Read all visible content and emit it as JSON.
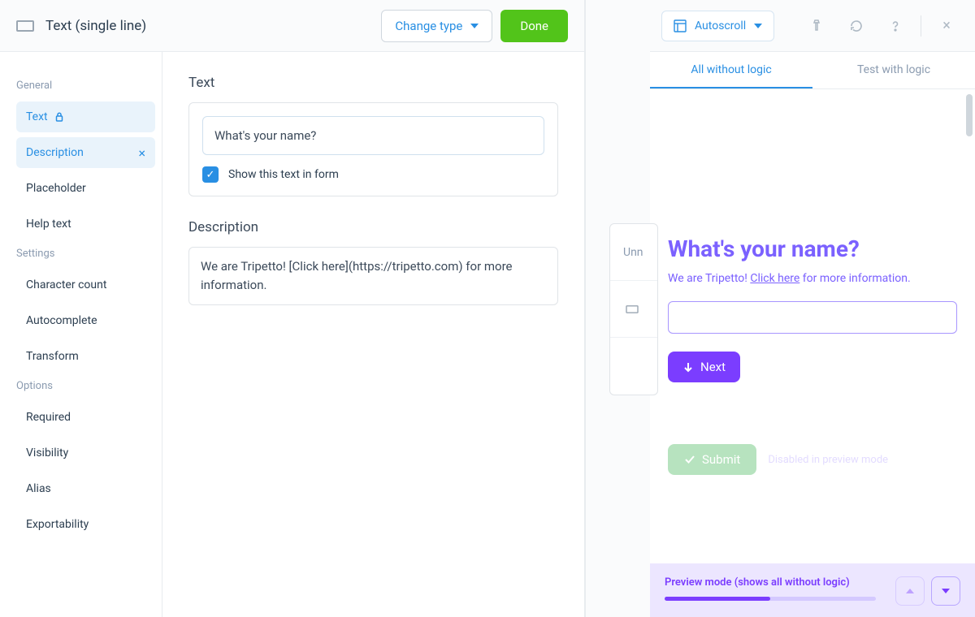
{
  "header": {
    "title": "Text (single line)",
    "change_type": "Change type",
    "done": "Done"
  },
  "sidebar": {
    "groups": [
      {
        "heading": "General",
        "items": [
          {
            "label": "Text",
            "active": true,
            "locked": true
          },
          {
            "label": "Description",
            "active": true,
            "closable": true
          },
          {
            "label": "Placeholder"
          },
          {
            "label": "Help text"
          }
        ]
      },
      {
        "heading": "Settings",
        "items": [
          {
            "label": "Character count"
          },
          {
            "label": "Autocomplete"
          },
          {
            "label": "Transform"
          }
        ]
      },
      {
        "heading": "Options",
        "items": [
          {
            "label": "Required"
          },
          {
            "label": "Visibility"
          },
          {
            "label": "Alias"
          },
          {
            "label": "Exportability"
          }
        ]
      }
    ]
  },
  "editor": {
    "text_label": "Text",
    "text_value": "What's your name?",
    "show_in_form": "Show this text in form",
    "description_label": "Description",
    "description_value": "We are Tripetto! [Click here](https://tripetto.com) for more information."
  },
  "peek": {
    "row1": "Unn"
  },
  "preview": {
    "toolbar": {
      "autoscroll": "Autoscroll"
    },
    "tabs": [
      "All without logic",
      "Test with logic"
    ],
    "question": {
      "title": "What's your name?",
      "desc_prefix": "We are Tripetto! ",
      "desc_link": "Click here",
      "desc_suffix": " for more information.",
      "next": "Next",
      "submit": "Submit",
      "disabled_note": "Disabled in preview mode"
    },
    "footer": {
      "text": "Preview mode (shows all without logic)"
    }
  }
}
